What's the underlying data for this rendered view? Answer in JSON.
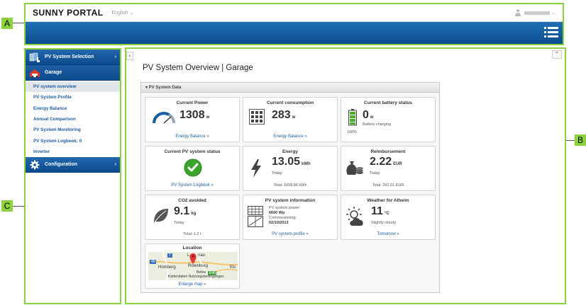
{
  "callouts": {
    "a": "A",
    "b": "B",
    "c": "C"
  },
  "header": {
    "logo": "SUNNY PORTAL",
    "language": "English",
    "language_caret": "⌄",
    "user_caret": "⌄",
    "menu_icon": "list-menu-icon"
  },
  "sidebar": {
    "pv_selection": "PV System Selection",
    "plant": "Garage",
    "items": [
      "PV system overview",
      "PV System Profile",
      "Energy Balance",
      "Annual Comparison",
      "PV System Monitoring",
      "PV System Logbook: 0",
      "Inverter"
    ],
    "configuration": "Configuration",
    "chevron": "›"
  },
  "main": {
    "collapse": "‹",
    "scroll_up": "⌃",
    "title": "PV System Overview | Garage",
    "panel_title": "▾ PV System Data"
  },
  "tiles": {
    "current_power": {
      "title": "Current Power",
      "value": "1308",
      "unit": "w",
      "link": "Energy Balance »"
    },
    "current_consumption": {
      "title": "Current consumption",
      "value": "283",
      "unit": "w",
      "link": "Energy Balance »"
    },
    "battery": {
      "title": "Current battery status",
      "value": "0",
      "unit": "w",
      "status": "Battery charging",
      "percent": "100%"
    },
    "pv_status": {
      "title": "Current PV system status",
      "link": "PV System Logbook »"
    },
    "energy": {
      "title": "Energy",
      "value": "13.05",
      "unit": "kWh",
      "period": "Today",
      "total": "Total: 1658.86 kWh"
    },
    "reimbursement": {
      "title": "Reimbursement",
      "value": "2.22",
      "unit": "EUR",
      "period": "Today",
      "total": "Total: 282.01 EUR"
    },
    "co2": {
      "title": "CO2 avoided",
      "value": "9.1",
      "unit": "kg",
      "period": "Today",
      "total": "Total: 1.2 t"
    },
    "pv_info": {
      "title": "PV system information",
      "power_label": "PV system power:",
      "power_value": "6600 Wp",
      "commission_label": "Commissioning:",
      "commission_value": "02/10/2013",
      "link": "PV system profile »"
    },
    "weather": {
      "title": "Weather for Alheim",
      "value": "11",
      "unit": "°C",
      "condition": "Slightly cloudy",
      "link": "Tomorrow »"
    },
    "location": {
      "title": "Location",
      "places": [
        "Homberg",
        "Rotenburg",
        "Bebra",
        "L",
        "nau",
        "Eis"
      ],
      "road_labels": [
        "49",
        "7",
        "E40"
      ],
      "map_footer": "Kartendaten   Nutzungsbedingungen",
      "link": "Enlarge map »"
    }
  },
  "colors": {
    "accent": "#8cd23c",
    "nav_blue": "#0c4b8d",
    "link_blue": "#1d5ea3",
    "ok_green": "#3aa52a"
  }
}
